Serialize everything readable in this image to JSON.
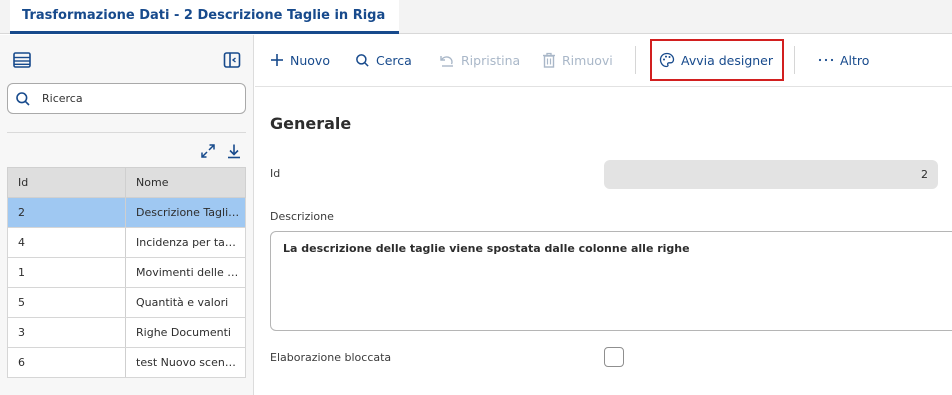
{
  "tab": {
    "title": "Trasformazione Dati - 2 Descrizione Taglie in Riga"
  },
  "left_panel": {
    "search": {
      "placeholder": "Ricerca"
    },
    "grid": {
      "headers": {
        "id": "Id",
        "nome": "Nome"
      },
      "rows": [
        {
          "id": "2",
          "nome": "Descrizione Taglie in Riga",
          "selected": true
        },
        {
          "id": "4",
          "nome": "Incidenza per taglia"
        },
        {
          "id": "1",
          "nome": "Movimenti delle taglie"
        },
        {
          "id": "5",
          "nome": "Quantità e valori"
        },
        {
          "id": "3",
          "nome": "Righe Documenti"
        },
        {
          "id": "6",
          "nome": "test Nuovo scenario"
        }
      ]
    }
  },
  "toolbar": {
    "nuovo": "Nuovo",
    "cerca": "Cerca",
    "ripristina": "Ripristina",
    "rimuovi": "Rimuovi",
    "avvia_designer": "Avvia designer",
    "altro": "Altro"
  },
  "form": {
    "section_title": "Generale",
    "id_label": "Id",
    "id_value": "2",
    "descrizione_label": "Descrizione",
    "descrizione_value": "La descrizione delle taglie viene spostata dalle colonne alle righe",
    "elaborazione_label": "Elaborazione bloccata",
    "elaborazione_checked": false
  },
  "colors": {
    "accent": "#174a8c",
    "selected_row": "#9fc8f2",
    "highlight_border": "#d21f1f",
    "disabled": "#a9b7c8"
  }
}
